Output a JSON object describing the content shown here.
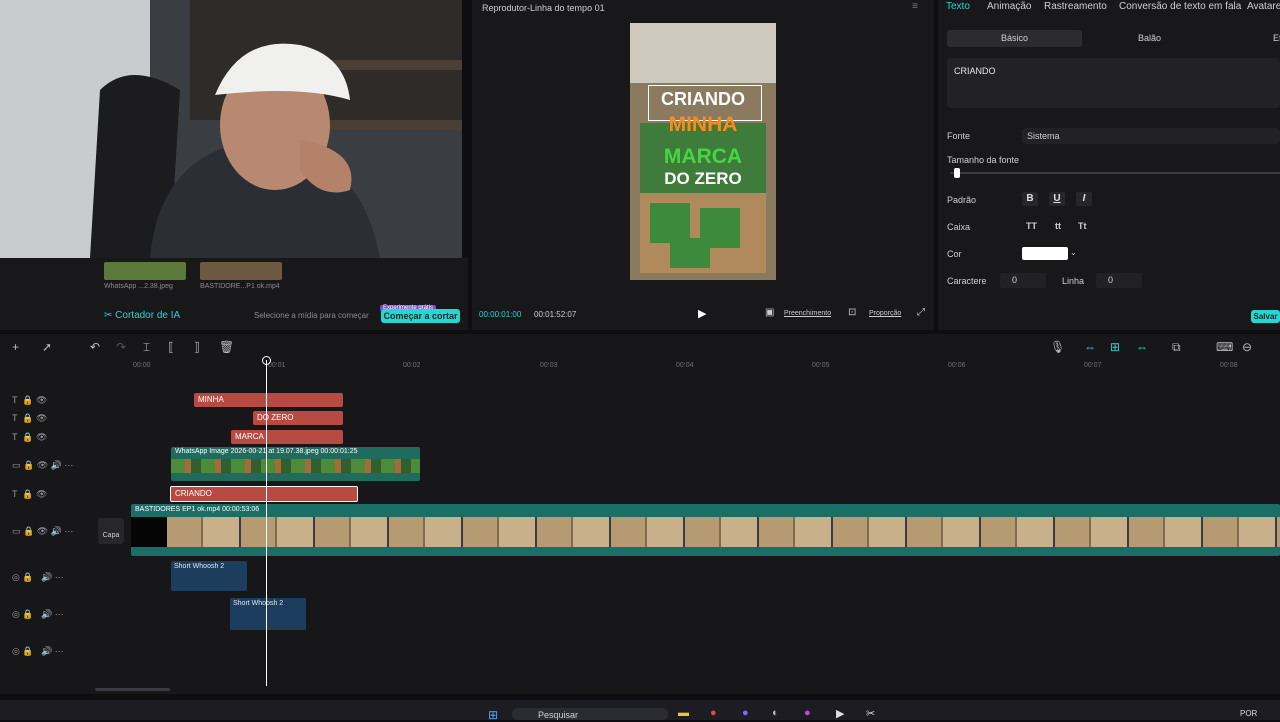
{
  "player": {
    "title": "Reprodutor-Linha do tempo 01",
    "current_time": "00:00:01:00",
    "total_time": "00:01:52:07",
    "fill_label": "Preenchimento",
    "ratio_label": "Proporção",
    "preview_lines": [
      "CRIANDO",
      "MINHA",
      "MARCA",
      "DO ZERO"
    ]
  },
  "media": {
    "items": [
      {
        "name": "WhatsApp ...2.38.jpeg"
      },
      {
        "name": "BASTIDORE...P1 ok.mp4"
      }
    ],
    "cutter_label": "Cortador de IA",
    "hint": "Selecione a mídia para começar",
    "start_cut_label": "Começar a cortar",
    "badge": "Experimente grátis"
  },
  "props": {
    "tabs": [
      "Texto",
      "Animação",
      "Rastreamento",
      "Conversão de texto em fala",
      "Avatares"
    ],
    "subtabs": [
      "Básico",
      "Balão",
      "Ef"
    ],
    "text_value": "CRIANDO",
    "font_label": "Fonte",
    "font_value": "Sistema",
    "font_size_label": "Tamanho da fonte",
    "pattern_label": "Padrão",
    "case_label": "Caixa",
    "case_options": [
      "TT",
      "tt",
      "Tt"
    ],
    "color_label": "Cor",
    "color_value": "#ffffff",
    "char_label": "Caractere",
    "char_value": "0",
    "line_label": "Linha",
    "line_value": "0",
    "save_label": "Salvar"
  },
  "timeline": {
    "ruler": [
      "00:00",
      "00:01",
      "00:02",
      "00:03",
      "00:04",
      "00:05",
      "00:06",
      "00:07",
      "00:08"
    ],
    "clips": {
      "minha": "MINHA",
      "dozero": "DO ZERO",
      "marca": "MARCA",
      "whatsapp": "WhatsApp Image 2026-00-21 at 19.07.38.jpeg   00:00:01:25",
      "criando": "CRIANDO",
      "bastidores": "BASTIDORES EP1 ok.mp4   00:00:53:06",
      "whoosh1": "Short Whoosh 2",
      "whoosh2": "Short Whoosh 2"
    },
    "cover_label": "Capa"
  },
  "taskbar": {
    "search": "Pesquisar",
    "lang": "POR"
  }
}
